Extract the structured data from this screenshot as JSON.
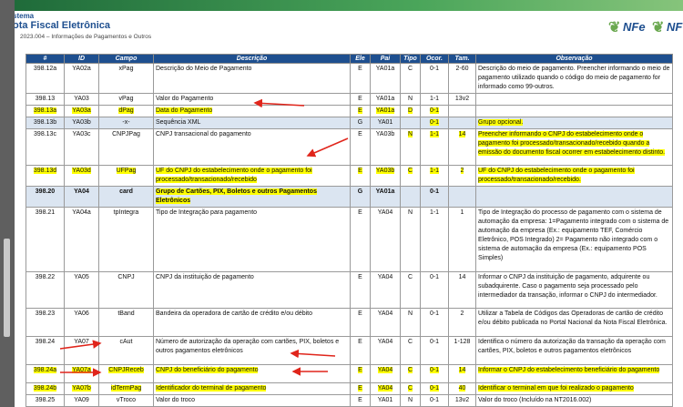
{
  "header": {
    "line1": "stema",
    "line2": "ota Fiscal Eletrônica",
    "line3": "2023.004 – Informações de Pagamentos e Outros",
    "logo1": "NFe",
    "logo2": "NF"
  },
  "columns": [
    "#",
    "ID",
    "Campo",
    "Descrição",
    "Ele",
    "Pai",
    "Tipo",
    "Ocor.",
    "Tam.",
    "Observação"
  ],
  "rows": [
    {
      "n": "398.12a",
      "id": "YA02a",
      "campo": "xPag",
      "desc": "Descrição do Meio de Pagamento",
      "ele": "E",
      "pai": "YA01a",
      "tipo": "C",
      "ocor": "0-1",
      "tam": "2-60",
      "obs": "Descrição do meio de pagamento. Preencher informando o meio de pagamento utilizado quando o código do meio de pagamento for informado como 99-outros.",
      "h": 31
    },
    {
      "n": "398.13",
      "id": "YA03",
      "campo": "vPag",
      "desc": "Valor do Pagamento",
      "ele": "E",
      "pai": "YA01a",
      "tipo": "N",
      "ocor": "1-1",
      "tam": "13v2",
      "obs": "",
      "h": 11
    },
    {
      "n": "398.13a",
      "id": "YA03a",
      "campo": "dPag",
      "desc": "Data do Pagamento",
      "ele": "E",
      "pai": "YA01a",
      "tipo": "D",
      "ocor": "0-1",
      "tam": "",
      "obs": "",
      "h": 11
    },
    {
      "n": "398.13b",
      "id": "YA03b",
      "campo": "-x-",
      "desc": "Sequência XML",
      "ele": "G",
      "pai": "YA01",
      "tipo": "",
      "ocor": "0-1",
      "tam": "",
      "obs": "Grupo opcional.",
      "h": 11
    },
    {
      "n": "398.13c",
      "id": "YA03c",
      "campo": "CNPJPag",
      "desc": "CNPJ transacional do pagamento",
      "ele": "E",
      "pai": "YA03b",
      "tipo": "N",
      "ocor": "1-1",
      "tam": "14",
      "obs": "Preencher informando o CNPJ do estabelecimento onde o pagamento foi processado/transacionado/recebido quando a emissão do documento fiscal ocorrer em estabelecimento distinto.",
      "h": 40
    },
    {
      "n": "398.13d",
      "id": "YA03d",
      "campo": "UFPag",
      "desc": "UF do CNPJ do estabelecimento onde o pagamento foi processado/transacionado/recebido",
      "ele": "E",
      "pai": "YA03b",
      "tipo": "C",
      "ocor": "1-1",
      "tam": "2",
      "obs": "UF do CNPJ do estabelecimento onde o pagamento foi processado/transacionado/recebido.",
      "h": 22
    },
    {
      "n": "398.20",
      "id": "YA04",
      "campo": "card",
      "desc": "Grupo de Cartões, PIX, Boletos e outros Pagamentos Eletrônicos",
      "ele": "G",
      "pai": "YA01a",
      "tipo": "",
      "ocor": "0-1",
      "tam": "",
      "obs": "",
      "h": 22
    },
    {
      "n": "398.21",
      "id": "YA04a",
      "campo": "tpIntegra",
      "desc": "Tipo de Integração para pagamento",
      "ele": "E",
      "pai": "YA04",
      "tipo": "N",
      "ocor": "1-1",
      "tam": "1",
      "obs": "Tipo de Integração do processo de pagamento com o sistema de automação da empresa: 1=Pagamento integrado com o sistema de automação da empresa (Ex.: equipamento TEF, Comércio Eletrônico, POS Integrado) 2= Pagamento não integrado com o sistema de automação da empresa (Ex.: equipamento POS Simples)",
      "h": 71
    },
    {
      "n": "398.22",
      "id": "YA05",
      "campo": "CNPJ",
      "desc": "CNPJ da instituição de pagamento",
      "ele": "E",
      "pai": "YA04",
      "tipo": "C",
      "ocor": "0-1",
      "tam": "14",
      "obs": "Informar o CNPJ da instituição de pagamento, adquirente ou subadquirente. Caso o pagamento seja processado pelo intermediador da transação, informar o CNPJ do intermediador.",
      "h": 40
    },
    {
      "n": "398.23",
      "id": "YA06",
      "campo": "tBand",
      "desc": "Bandeira da operadora de cartão de crédito e/ou débito",
      "ele": "E",
      "pai": "YA04",
      "tipo": "N",
      "ocor": "0-1",
      "tam": "2",
      "obs": "Utilizar a Tabela de Códigos das Operadoras de cartão de crédito e/ou débito publicada no Portal Nacional da Nota Fiscal Eletrônica.",
      "h": 31
    },
    {
      "n": "398.24",
      "id": "YA07",
      "campo": "cAut",
      "desc": "Número de autorização da operação com cartões, PIX, boletos e outros pagamentos eletrônicos",
      "ele": "E",
      "pai": "YA04",
      "tipo": "C",
      "ocor": "0-1",
      "tam": "1-128",
      "obs": "Identifica o número da autorização da transação da operação com cartões, PIX, boletos e outros pagamentos eletrônicos",
      "h": 31
    },
    {
      "n": "398.24a",
      "id": "YA07a",
      "campo": "CNPJReceb",
      "desc": "CNPJ do beneficiário do pagamento",
      "ele": "E",
      "pai": "YA04",
      "tipo": "C",
      "ocor": "0-1",
      "tam": "14",
      "obs": "Informar o CNPJ do estabelecimento beneficiário do pagamento",
      "h": 20
    },
    {
      "n": "398.24b",
      "id": "YA07b",
      "campo": "idTermPag",
      "desc": "Identificador do terminal de pagamento",
      "ele": "E",
      "pai": "YA04",
      "tipo": "C",
      "ocor": "0-1",
      "tam": "40",
      "obs": "Identificar o terminal em que foi realizado o pagamento",
      "h": 11
    },
    {
      "n": "398.25",
      "id": "YA09",
      "campo": "vTroco",
      "desc": "Valor do troco",
      "ele": "E",
      "pai": "YA01",
      "tipo": "N",
      "ocor": "0-1",
      "tam": "13v2",
      "obs": "Valor do troco (Incluído na NT2016.002)",
      "h": 11
    }
  ],
  "colors": {
    "header_bg": "#1e4f8f",
    "group_bg": "#dbe5f1",
    "highlight": "#ffff00",
    "arrow": "#e0251b"
  }
}
